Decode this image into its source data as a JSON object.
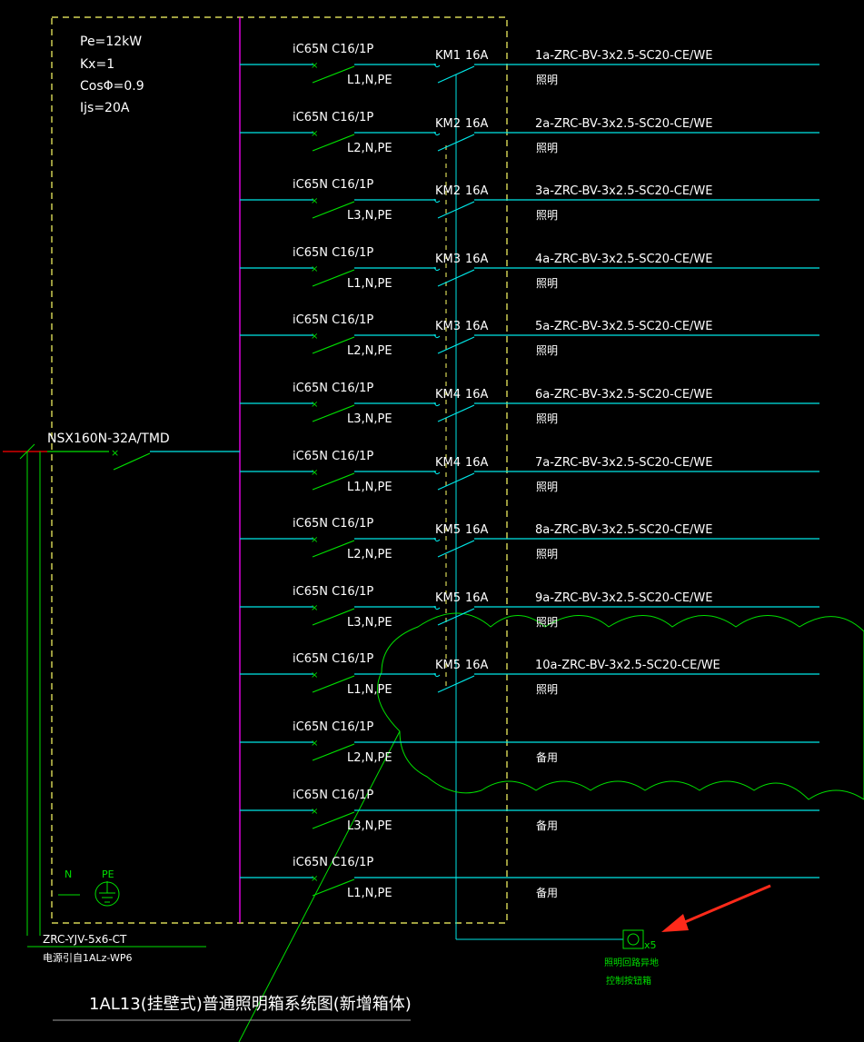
{
  "colors": {
    "background": "#000000",
    "text": "#ffffff",
    "cyan": "#00e5e5",
    "green": "#00e000",
    "magenta": "#ff00ff",
    "yellow": "#ffff66",
    "red": "#ff0000",
    "grey": "#a0a0a0",
    "arrow": "#ff2a1a"
  },
  "box_params": [
    "Pe=12kW",
    "Kx=1",
    "CosΦ=0.9",
    "Ijs=20A"
  ],
  "main_breaker": "NSX160N-32A/TMD",
  "circuits": [
    {
      "breaker": "iC65N C16/1P",
      "phase": "L1,N,PE",
      "contactor": "KM1",
      "rating": "16A",
      "cable": "1a-ZRC-BV-3x2.5-SC20-CE/WE",
      "use": "照明"
    },
    {
      "breaker": "iC65N C16/1P",
      "phase": "L2,N,PE",
      "contactor": "KM2",
      "rating": "16A",
      "cable": "2a-ZRC-BV-3x2.5-SC20-CE/WE",
      "use": "照明"
    },
    {
      "breaker": "iC65N C16/1P",
      "phase": "L3,N,PE",
      "contactor": "KM2",
      "rating": "16A",
      "cable": "3a-ZRC-BV-3x2.5-SC20-CE/WE",
      "use": "照明"
    },
    {
      "breaker": "iC65N C16/1P",
      "phase": "L1,N,PE",
      "contactor": "KM3",
      "rating": "16A",
      "cable": "4a-ZRC-BV-3x2.5-SC20-CE/WE",
      "use": "照明"
    },
    {
      "breaker": "iC65N C16/1P",
      "phase": "L2,N,PE",
      "contactor": "KM3",
      "rating": "16A",
      "cable": "5a-ZRC-BV-3x2.5-SC20-CE/WE",
      "use": "照明"
    },
    {
      "breaker": "iC65N C16/1P",
      "phase": "L3,N,PE",
      "contactor": "KM4",
      "rating": "16A",
      "cable": "6a-ZRC-BV-3x2.5-SC20-CE/WE",
      "use": "照明"
    },
    {
      "breaker": "iC65N C16/1P",
      "phase": "L1,N,PE",
      "contactor": "KM4",
      "rating": "16A",
      "cable": "7a-ZRC-BV-3x2.5-SC20-CE/WE",
      "use": "照明"
    },
    {
      "breaker": "iC65N C16/1P",
      "phase": "L2,N,PE",
      "contactor": "KM5",
      "rating": "16A",
      "cable": "8a-ZRC-BV-3x2.5-SC20-CE/WE",
      "use": "照明"
    },
    {
      "breaker": "iC65N C16/1P",
      "phase": "L3,N,PE",
      "contactor": "KM5",
      "rating": "16A",
      "cable": "9a-ZRC-BV-3x2.5-SC20-CE/WE",
      "use": "照明"
    },
    {
      "breaker": "iC65N C16/1P",
      "phase": "L1,N,PE",
      "contactor": "KM5",
      "rating": "16A",
      "cable": "10a-ZRC-BV-3x2.5-SC20-CE/WE",
      "use": "照明"
    },
    {
      "breaker": "iC65N C16/1P",
      "phase": "L2,N,PE",
      "contactor": "",
      "rating": "",
      "cable": "",
      "use": "备用"
    },
    {
      "breaker": "iC65N C16/1P",
      "phase": "L3,N,PE",
      "contactor": "",
      "rating": "",
      "cable": "",
      "use": "备用"
    },
    {
      "breaker": "iC65N C16/1P",
      "phase": "L1,N,PE",
      "contactor": "",
      "rating": "",
      "cable": "",
      "use": "备用"
    }
  ],
  "n_label": "N",
  "pe_label": "PE",
  "incoming_cable": "ZRC-YJV-5x6-CT",
  "incoming_source": "电源引自1ALz-WP6",
  "control_box_count": "5",
  "control_box_label": [
    "照明回路异地",
    "控制按钮箱"
  ],
  "title": "1AL13(挂壁式)普通照明箱系统图(新增箱体)"
}
